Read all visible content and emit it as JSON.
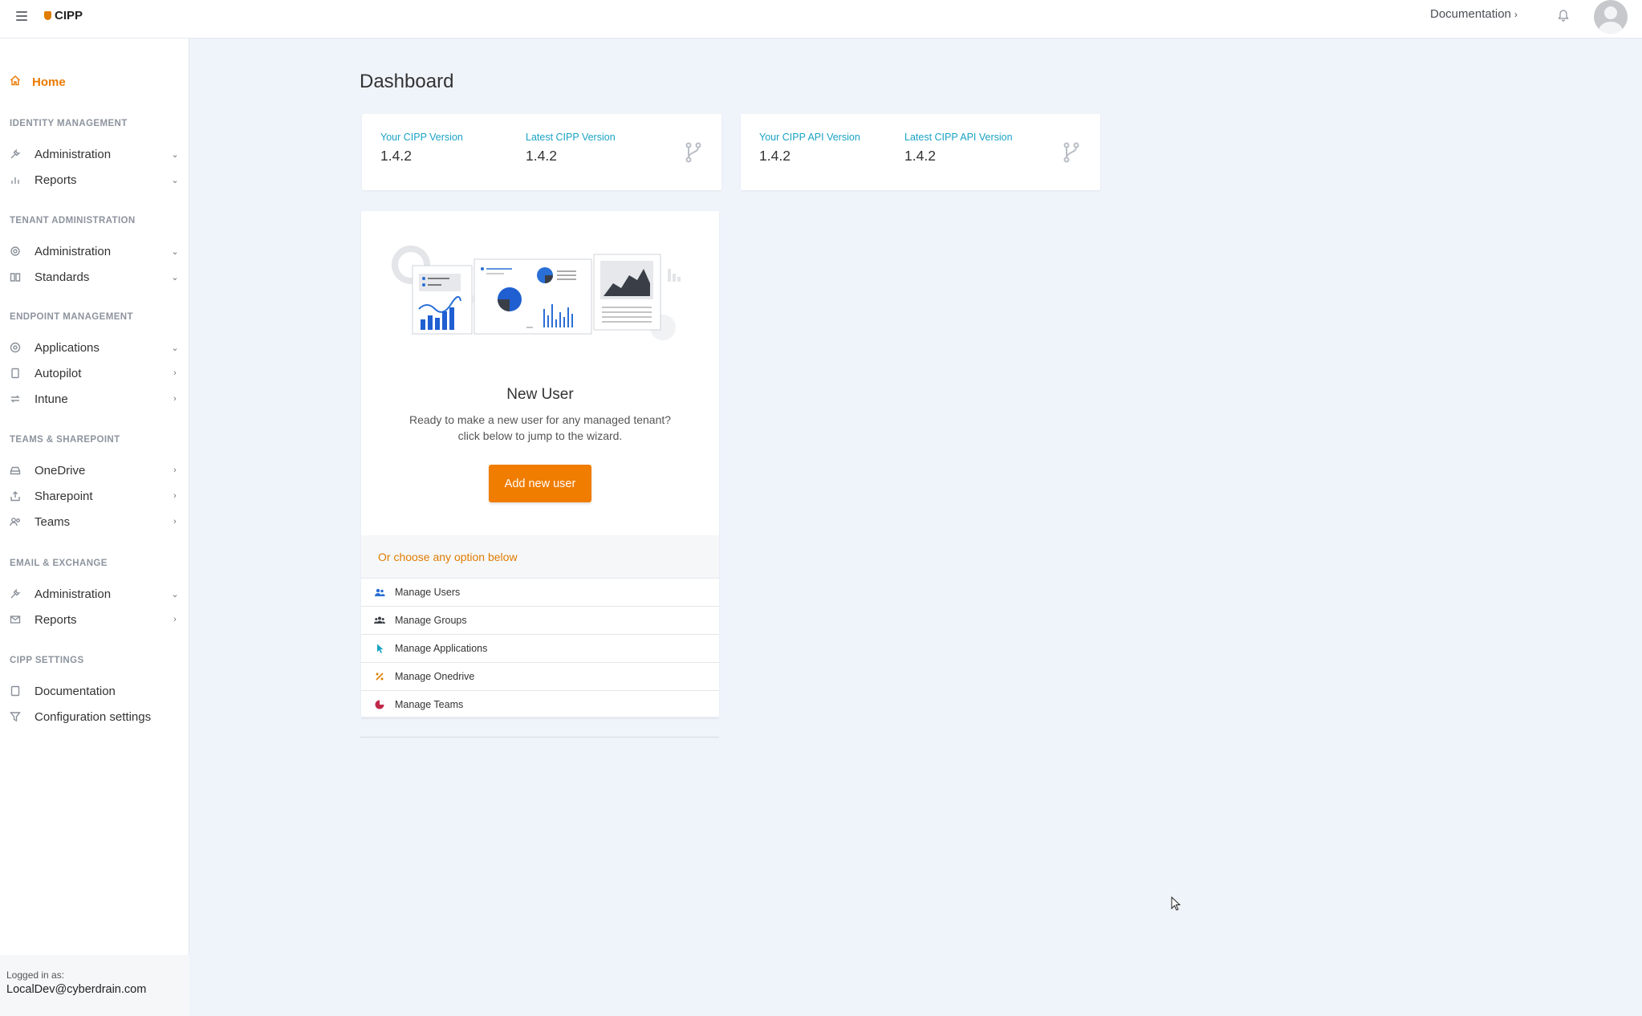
{
  "header": {
    "brand": "CIPP",
    "documentation_link": "Documentation"
  },
  "sidebar": {
    "home": "Home",
    "sections": [
      {
        "title": "IDENTITY MANAGEMENT",
        "items": [
          {
            "label": "Administration",
            "icon": "wrench-icon"
          },
          {
            "label": "Reports",
            "icon": "chart-icon"
          }
        ]
      },
      {
        "title": "TENANT ADMINISTRATION",
        "items": [
          {
            "label": "Administration",
            "icon": "gear-icon"
          },
          {
            "label": "Standards",
            "icon": "book-icon"
          }
        ]
      },
      {
        "title": "ENDPOINT MANAGEMENT",
        "items": [
          {
            "label": "Applications",
            "icon": "globe-icon"
          },
          {
            "label": "Autopilot",
            "icon": "tablet-icon"
          },
          {
            "label": "Intune",
            "icon": "sync-icon"
          }
        ]
      },
      {
        "title": "TEAMS & SHAREPOINT",
        "items": [
          {
            "label": "OneDrive",
            "icon": "drive-icon"
          },
          {
            "label": "Sharepoint",
            "icon": "share-icon"
          },
          {
            "label": "Teams",
            "icon": "people-icon"
          }
        ]
      },
      {
        "title": "EMAIL & EXCHANGE",
        "items": [
          {
            "label": "Administration",
            "icon": "wrench-icon"
          },
          {
            "label": "Reports",
            "icon": "mail-icon"
          }
        ]
      },
      {
        "title": "CIPP SETTINGS",
        "items": [
          {
            "label": "Documentation",
            "icon": "book-icon"
          },
          {
            "label": "Configuration settings",
            "icon": "filter-icon"
          }
        ]
      }
    ],
    "footer": {
      "label": "Logged in as:",
      "user": "LocalDev@cyberdrain.com"
    }
  },
  "main": {
    "title": "Dashboard",
    "version_cards": [
      {
        "left_label": "Your CIPP Version",
        "left_value": "1.4.2",
        "right_label": "Latest CIPP Version",
        "right_value": "1.4.2"
      },
      {
        "left_label": "Your CIPP API Version",
        "left_value": "1.4.2",
        "right_label": "Latest CIPP API Version",
        "right_value": "1.4.2"
      }
    ],
    "new_user": {
      "title": "New User",
      "description_line1": "Ready to make a new user for any managed tenant?",
      "description_line2": "click below to jump to the wizard.",
      "button": "Add new user",
      "options_header": "Or choose any option below",
      "options": [
        {
          "label": "Manage Users",
          "icon": "users-icon",
          "color": "#2a6fd6"
        },
        {
          "label": "Manage Groups",
          "icon": "group-icon",
          "color": "#3a3f47"
        },
        {
          "label": "Manage Applications",
          "icon": "pointer-icon",
          "color": "#1aa3c4"
        },
        {
          "label": "Manage Onedrive",
          "icon": "percent-icon",
          "color": "#e07c00"
        },
        {
          "label": "Manage Teams",
          "icon": "pie-icon",
          "color": "#c0284a"
        }
      ]
    }
  },
  "colors": {
    "accent": "#f07c00",
    "link": "#1aa3c4",
    "background": "#eff3fa"
  }
}
